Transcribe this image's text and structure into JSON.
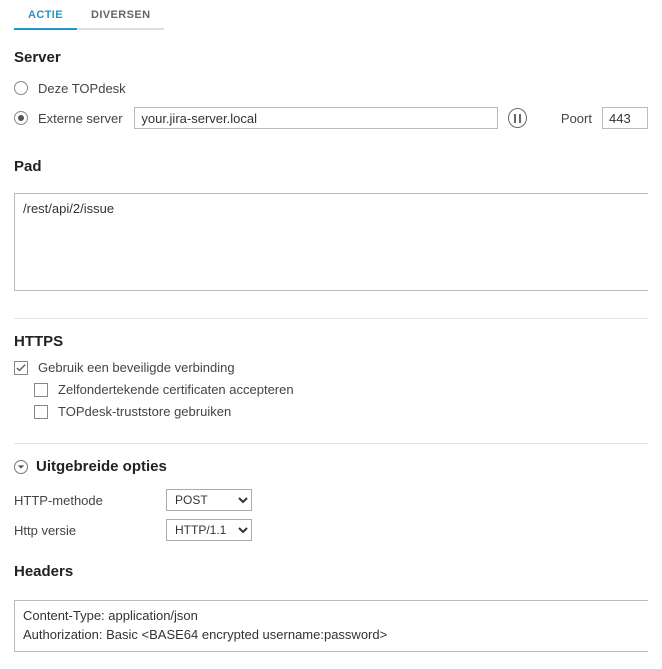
{
  "tabs": {
    "actie": "ACTIE",
    "diversen": "DIVERSEN"
  },
  "server": {
    "title": "Server",
    "opt_this": "Deze TOPdesk",
    "opt_ext": "Externe server",
    "ext_value": "your.jira-server.local",
    "port_label": "Poort",
    "port_value": "443"
  },
  "path": {
    "title": "Pad",
    "value": "/rest/api/2/issue"
  },
  "https": {
    "title": "HTTPS",
    "secure": "Gebruik een beveiligde verbinding",
    "selfsigned": "Zelfondertekende certificaten accepteren",
    "truststore": "TOPdesk-truststore gebruiken"
  },
  "advanced": {
    "title": "Uitgebreide opties",
    "method_label": "HTTP-methode",
    "method_value": "POST",
    "version_label": "Http versie",
    "version_value": "HTTP/1.1"
  },
  "headers": {
    "title": "Headers",
    "value": "Content-Type: application/json\nAuthorization: Basic <BASE64 encrypted username:password>"
  }
}
